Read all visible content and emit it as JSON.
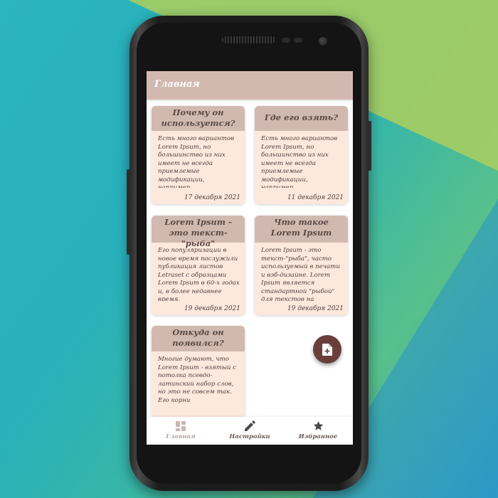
{
  "appbar": {
    "title": "Главная"
  },
  "cards": [
    {
      "title": "Почему он используется?",
      "body": "Есть много вариантов Lorem Ipsum, но большинство из них имеет не всегда приемлемые модификации, например,",
      "date": "17 декабря 2021"
    },
    {
      "title": "Где его взять?",
      "body": "Есть много вариантов Lorem Ipsum, но большинство из них имеет не всегда приемлемые модификации, например,",
      "date": "11 декабря 2021"
    },
    {
      "title": "Lorem Ipsum - это текст-\"рыба\"",
      "body": "Его популяризации в новое время послужили публикация листов Letraset с образцами Lorem Ipsum в 60-х годах и, в более недавнее время,",
      "date": "19 декабря 2021"
    },
    {
      "title": "Что такое Lorem Ipsum",
      "body": "Lorem Ipsum - это текст-\"рыба\", часто используемый в печати и вэб-дизайне. Lorem Ipsum является стандартной \"рыбой\" для текстов на",
      "date": "19 декабря 2021"
    },
    {
      "title": "Откуда он появился?",
      "body": "Многие думают, что Lorem Ipsum - взятый с потолка псевдо-латинский набор слов, но это не совсем так. Его корни",
      "date": ""
    }
  ],
  "fab": {
    "icon": "note-add-icon"
  },
  "bottom_nav": [
    {
      "label": "Главная",
      "icon": "dashboard-icon",
      "active": true
    },
    {
      "label": "Настройки",
      "icon": "pencil-icon",
      "active": false
    },
    {
      "label": "Избранное",
      "icon": "star-icon",
      "active": false
    }
  ],
  "colors": {
    "accent": "#d2b9b0",
    "card": "#fde8dc",
    "fab": "#6a3f3a"
  }
}
